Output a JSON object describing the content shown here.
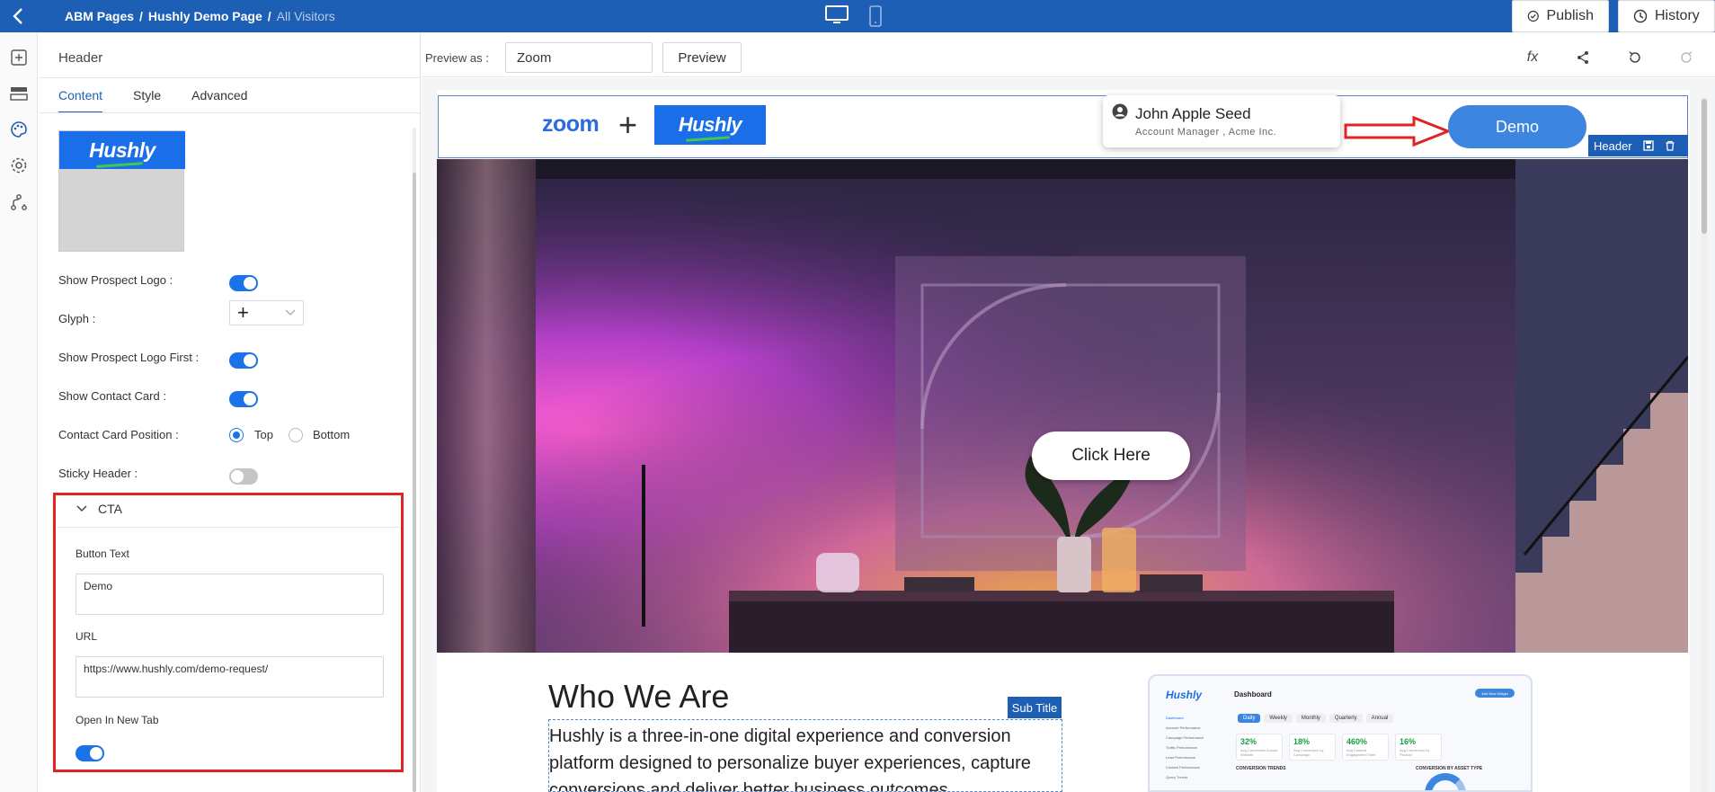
{
  "topbar": {
    "breadcrumb": [
      "ABM Pages",
      "Hushly Demo Page",
      "All Visitors"
    ],
    "separator": "/",
    "publish_label": "Publish",
    "history_label": "History"
  },
  "panel": {
    "title": "Header",
    "tabs": [
      {
        "label": "Content",
        "active": true
      },
      {
        "label": "Style",
        "active": false
      },
      {
        "label": "Advanced",
        "active": false
      }
    ],
    "logo_text": "Hushly",
    "settings": {
      "show_prospect_logo": {
        "label": "Show Prospect Logo :",
        "on": true
      },
      "glyph": {
        "label": "Glyph :",
        "value": "+"
      },
      "show_prospect_logo_first": {
        "label": "Show Prospect Logo First :",
        "on": true
      },
      "show_contact_card": {
        "label": "Show Contact Card :",
        "on": true
      },
      "contact_card_position": {
        "label": "Contact Card Position :",
        "options": [
          "Top",
          "Bottom"
        ],
        "selected": "Top"
      },
      "sticky_header": {
        "label": "Sticky Header :",
        "on": false
      }
    },
    "cta": {
      "section_label": "CTA",
      "button_text_label": "Button Text",
      "button_text_value": "Demo",
      "url_label": "URL",
      "url_value": "https://www.hushly.com/demo-request/",
      "new_tab_label": "Open In New Tab",
      "new_tab_on": true
    }
  },
  "preview_bar": {
    "preview_as_label": "Preview as :",
    "preview_as_value": "Zoom",
    "preview_button": "Preview",
    "fx_label": "fx"
  },
  "page": {
    "prospect_logo": "zoom",
    "glyph": "+",
    "brand_logo": "Hushly",
    "contact_name": "John Apple Seed",
    "contact_role": "Account Manager , Acme Inc.",
    "demo_button": "Demo",
    "header_tag": "Header",
    "hero_button": "Click Here",
    "who_title": "Who We Are",
    "subtitle_tag": "Sub Title",
    "who_body": "Hushly is a three-in-one digital experience and conversion platform designed to personalize buyer experiences, capture conversions and deliver better business outcomes."
  },
  "dashboard": {
    "logo": "Hushly",
    "title": "Dashboard",
    "add_button": "Add New Widget",
    "tabs": [
      "Daily",
      "Weekly",
      "Monthly",
      "Quarterly",
      "Annual"
    ],
    "stats": [
      {
        "value": "32%",
        "label": "Avg Conversion Across Website"
      },
      {
        "value": "18%",
        "label": "Avg Conversion by Campaign"
      },
      {
        "value": "460%",
        "label": "Avg Content Engagement Time"
      },
      {
        "value": "16%",
        "label": "Avg Conversion by Product"
      }
    ],
    "side_items": [
      "Dashboard",
      "Account Performance",
      "Campaign Performance",
      "Traffic Performance",
      "Lead Performance",
      "Content Performance",
      "Query Trends"
    ],
    "section_left": "CONVERSION TRENDS",
    "section_right": "CONVERSION BY ASSET TYPE"
  },
  "colors": {
    "brand_blue": "#1d5fb5",
    "toggle_on": "#1a73e8",
    "highlight_red": "#e02424",
    "demo_button": "#3d86e0"
  }
}
